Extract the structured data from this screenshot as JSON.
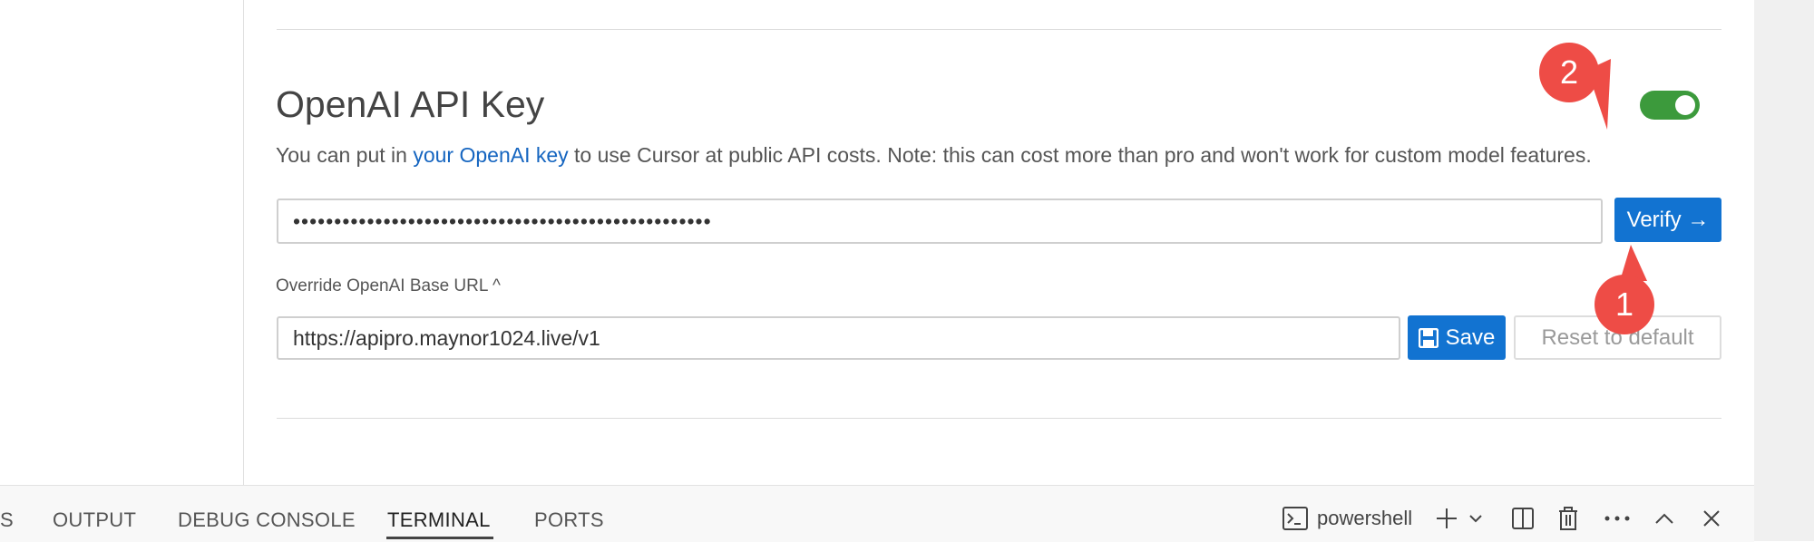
{
  "section": {
    "title": "OpenAI API Key",
    "description_prefix": "You can put in ",
    "description_link": "your OpenAI key",
    "description_suffix": " to use Cursor at public API costs. Note: this can cost more than pro and won't work for custom model features.",
    "toggle_on": true
  },
  "key_input": {
    "value": "•••••••••••••••••••••••••••••••••••••••••••••••••••"
  },
  "verify_button": {
    "label": "Verify →"
  },
  "override": {
    "label": "Override OpenAI Base URL ^"
  },
  "url_input": {
    "value": "https://apipro.maynor1024.live/v1"
  },
  "save_button": {
    "label": "Save"
  },
  "reset_button": {
    "label": "Reset to default"
  },
  "annotations": {
    "badge_1": "1",
    "badge_2": "2"
  },
  "bottom_panel": {
    "tabs": [
      "S",
      "OUTPUT",
      "DEBUG CONSOLE",
      "TERMINAL",
      "PORTS"
    ],
    "active_tab": "TERMINAL",
    "shell_label": "powershell"
  },
  "colors": {
    "accent": "#1273d1",
    "toggle": "#3c9a3c",
    "badge": "#ee4c46",
    "link": "#1565c0"
  },
  "icons": [
    "terminal-icon",
    "plus-icon",
    "chevron-down-icon",
    "split-icon",
    "trash-icon",
    "more-icon",
    "chevron-up-icon",
    "close-icon",
    "save-icon"
  ]
}
